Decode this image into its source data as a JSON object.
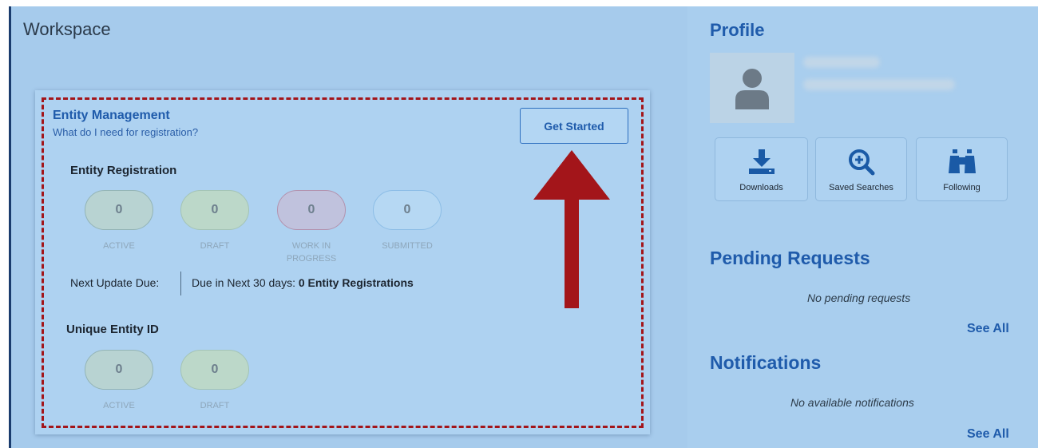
{
  "workspace": {
    "title": "Workspace"
  },
  "entity_management": {
    "title": "Entity Management",
    "help_link": "What do I need for registration?",
    "get_started_label": "Get Started",
    "entity_registration": {
      "title": "Entity Registration",
      "counters": [
        {
          "value": "0",
          "label": "ACTIVE"
        },
        {
          "value": "0",
          "label": "DRAFT"
        },
        {
          "value": "0",
          "label": "WORK IN PROGRESS"
        },
        {
          "value": "0",
          "label": "SUBMITTED"
        }
      ],
      "next_update_label": "Next Update Due:",
      "due_prefix": "Due in Next 30 days:",
      "due_value": "0 Entity Registrations"
    },
    "unique_entity_id": {
      "title": "Unique Entity ID",
      "counters": [
        {
          "value": "0",
          "label": "ACTIVE"
        },
        {
          "value": "0",
          "label": "DRAFT"
        }
      ]
    }
  },
  "profile": {
    "title": "Profile",
    "quick_links": [
      {
        "label": "Downloads",
        "icon": "download-icon"
      },
      {
        "label": "Saved Searches",
        "icon": "magnifier-plus-icon"
      },
      {
        "label": "Following",
        "icon": "binoculars-icon"
      }
    ]
  },
  "pending_requests": {
    "title": "Pending Requests",
    "empty_message": "No pending requests",
    "see_all_label": "See All"
  },
  "notifications": {
    "title": "Notifications",
    "empty_message": "No available notifications",
    "see_all_label": "See All"
  },
  "colors": {
    "accent": "#1f5bab",
    "highlight_dash": "#a3151a",
    "arrow": "#a3151a",
    "panel_bg": "#a6cbec"
  }
}
